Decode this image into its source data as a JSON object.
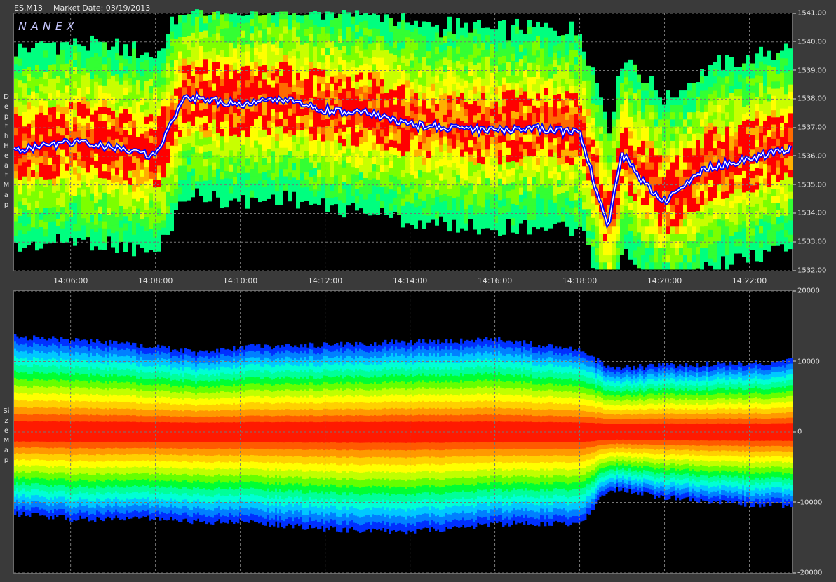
{
  "header": {
    "symbol": "ES.M13",
    "market_date": "Market Date: 03/19/2013"
  },
  "logo": "NANEX",
  "panel1_label": "Depth Heat Map",
  "panel2_label": "Size Map",
  "chart_data": [
    {
      "type": "heatmap",
      "title": "Depth Heat Map",
      "x_ticks": [
        "14:06:00",
        "14:08:00",
        "14:10:00",
        "14:12:00",
        "14:14:00",
        "14:16:00",
        "14:18:00",
        "14:20:00",
        "14:22:00"
      ],
      "y_ticks": [
        "1541.00",
        "1540.00",
        "1539.00",
        "1538.00",
        "1537.00",
        "1536.00",
        "1535.00",
        "1534.00",
        "1533.00",
        "1532.00"
      ],
      "ylim": [
        1532,
        1541
      ],
      "x_range": [
        "14:04:40",
        "14:23:00"
      ],
      "colors": {
        "high": "#ff0000",
        "mid": "#ffff00",
        "low": "#00ff00",
        "trade": "#0000ff"
      },
      "last_price_series": {
        "times": [
          "14:04:40",
          "14:06:00",
          "14:07:00",
          "14:08:00",
          "14:08:40",
          "14:10:00",
          "14:11:00",
          "14:12:00",
          "14:13:00",
          "14:14:00",
          "14:15:00",
          "14:16:00",
          "14:17:00",
          "14:18:00",
          "14:18:40",
          "14:19:00",
          "14:19:30",
          "14:20:00",
          "14:21:00",
          "14:22:00",
          "14:23:00"
        ],
        "prices": [
          1536.2,
          1536.5,
          1536.3,
          1536.0,
          1538.1,
          1537.8,
          1538.0,
          1537.6,
          1537.5,
          1537.1,
          1537.0,
          1536.9,
          1537.0,
          1536.8,
          1533.5,
          1536.1,
          1535.1,
          1534.4,
          1535.6,
          1535.9,
          1536.3
        ]
      }
    },
    {
      "type": "area",
      "title": "Size Map",
      "x_ticks": [
        "14:06:00",
        "14:08:00",
        "14:10:00",
        "14:12:00",
        "14:14:00",
        "14:16:00",
        "14:18:00",
        "14:20:00",
        "14:22:00"
      ],
      "y_ticks": [
        "20000",
        "10000",
        "0",
        "-10000",
        "-20000"
      ],
      "ylim": [
        -20000,
        20000
      ],
      "upper_envelope": {
        "times": [
          "14:04:40",
          "14:06:00",
          "14:08:00",
          "14:09:00",
          "14:10:00",
          "14:12:00",
          "14:14:00",
          "14:16:00",
          "14:18:00",
          "14:18:40",
          "14:20:00",
          "14:22:00",
          "14:23:00"
        ],
        "values": [
          14000,
          13500,
          12500,
          11700,
          12500,
          12800,
          13200,
          13600,
          12000,
          9500,
          9800,
          10200,
          10500
        ]
      },
      "lower_envelope": {
        "times": [
          "14:04:40",
          "14:06:00",
          "14:08:00",
          "14:09:00",
          "14:10:00",
          "14:12:00",
          "14:14:00",
          "14:16:00",
          "14:18:00",
          "14:18:40",
          "14:20:00",
          "14:22:00",
          "14:23:00"
        ],
        "values": [
          -12000,
          -12800,
          -12700,
          -13200,
          -13200,
          -14200,
          -14600,
          -13500,
          -13500,
          -8500,
          -9800,
          -10700,
          -11000
        ]
      }
    }
  ]
}
